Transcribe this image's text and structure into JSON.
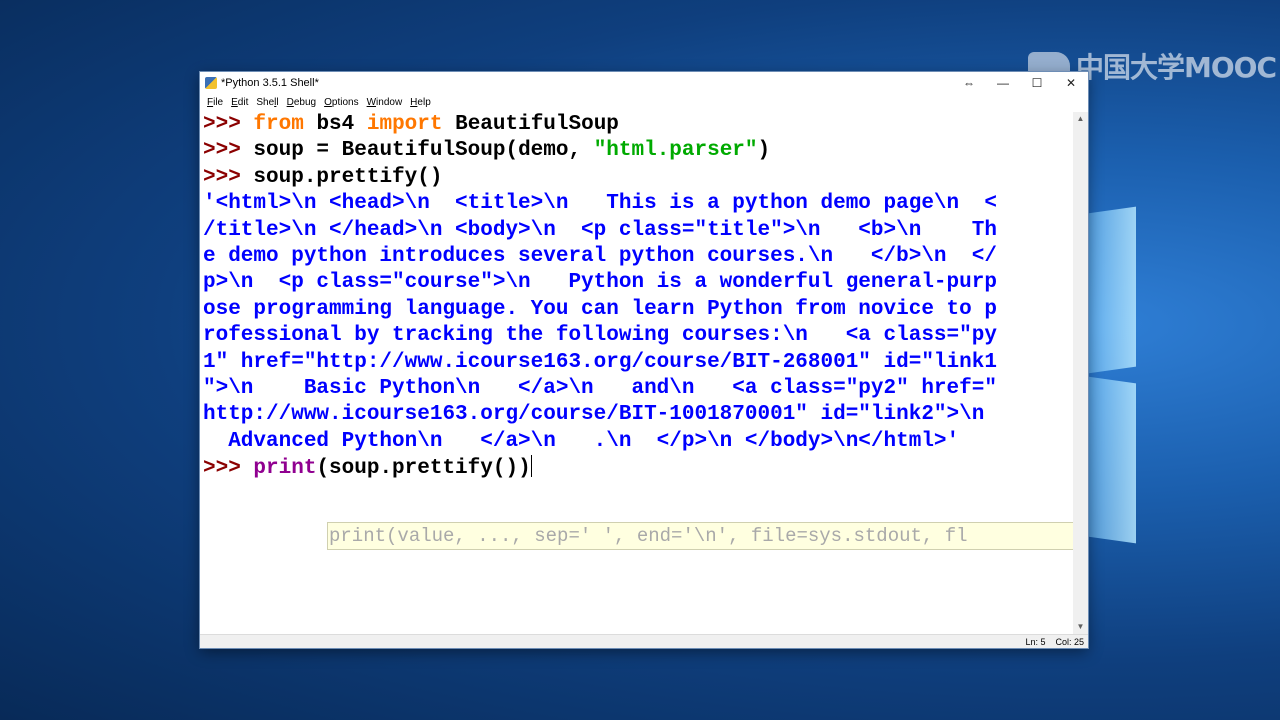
{
  "window": {
    "title": "*Python 3.5.1 Shell*",
    "controls": {
      "restore": "⇔",
      "minimize": "—",
      "maximize": "☐",
      "close": "✕"
    }
  },
  "watermark": {
    "text": "中国大学MOOC"
  },
  "menu": [
    {
      "underline": "F",
      "rest": "ile"
    },
    {
      "underline": "E",
      "rest": "dit"
    },
    {
      "pre": "She",
      "underline": "l",
      "rest": "l"
    },
    {
      "underline": "D",
      "rest": "ebug"
    },
    {
      "underline": "O",
      "rest": "ptions"
    },
    {
      "underline": "W",
      "rest": "indow"
    },
    {
      "underline": "H",
      "rest": "elp"
    }
  ],
  "shell": {
    "prompt": ">>> ",
    "cmd1": {
      "kw_from": "from",
      "module": " bs4 ",
      "kw_import": "import",
      "name": " BeautifulSoup"
    },
    "cmd2": {
      "code": "soup = BeautifulSoup(demo, ",
      "string": "\"html.parser\"",
      "end": ")"
    },
    "cmd3": {
      "code": "soup.prettify()"
    },
    "output_lines": [
      "'<html>\\n <head>\\n  <title>\\n   This is a python demo page\\n  <",
      "/title>\\n </head>\\n <body>\\n  <p class=\"title\">\\n   <b>\\n    Th",
      "e demo python introduces several python courses.\\n   </b>\\n  </",
      "p>\\n  <p class=\"course\">\\n   Python is a wonderful general-purp",
      "ose programming language. You can learn Python from novice to p",
      "rofessional by tracking the following courses:\\n   <a class=\"py",
      "1\" href=\"http://www.icourse163.org/course/BIT-268001\" id=\"link1",
      "\">\\n    Basic Python\\n   </a>\\n   and\\n   <a class=\"py2\" href=\"",
      "http://www.icourse163.org/course/BIT-1001870001\" id=\"link2\">\\n",
      "  Advanced Python\\n   </a>\\n   .\\n  </p>\\n </body>\\n</html>'"
    ],
    "cmd4": {
      "builtin": "print",
      "code": "(soup.prettify())"
    },
    "calltip": "print(value, ..., sep=' ', end='\\n', file=sys.stdout, fl"
  },
  "status": {
    "line": "Ln: 5",
    "col": "Col: 25"
  }
}
